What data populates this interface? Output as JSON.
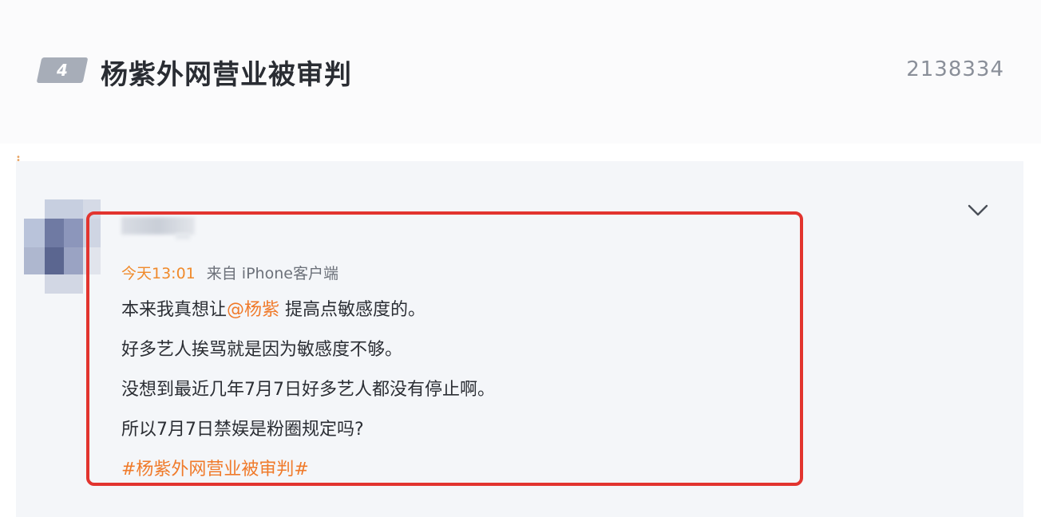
{
  "trend": {
    "rank": "4",
    "title": "杨紫外网营业被审判",
    "count": "2138334"
  },
  "post": {
    "time": "今天13:01",
    "source": "来自 iPhone客户端",
    "line1_prefix": "本来我真想让",
    "line1_mention": "@杨紫",
    "line1_suffix": " 提高点敏感度的。",
    "line2": "好多艺人挨骂就是因为敏感度不够。",
    "line3": "没想到最近几年7月7日好多艺人都没有停止啊。",
    "line4": "所以7月7日禁娱是粉圈规定吗?",
    "hashtag": "#杨紫外网营业被审判#"
  },
  "icons": {
    "chevron": "chevron-down-icon"
  },
  "colors": {
    "accent_orange": "#f07a2a",
    "highlight_red": "#e2342f",
    "rank_badge": "#a7adb8"
  }
}
